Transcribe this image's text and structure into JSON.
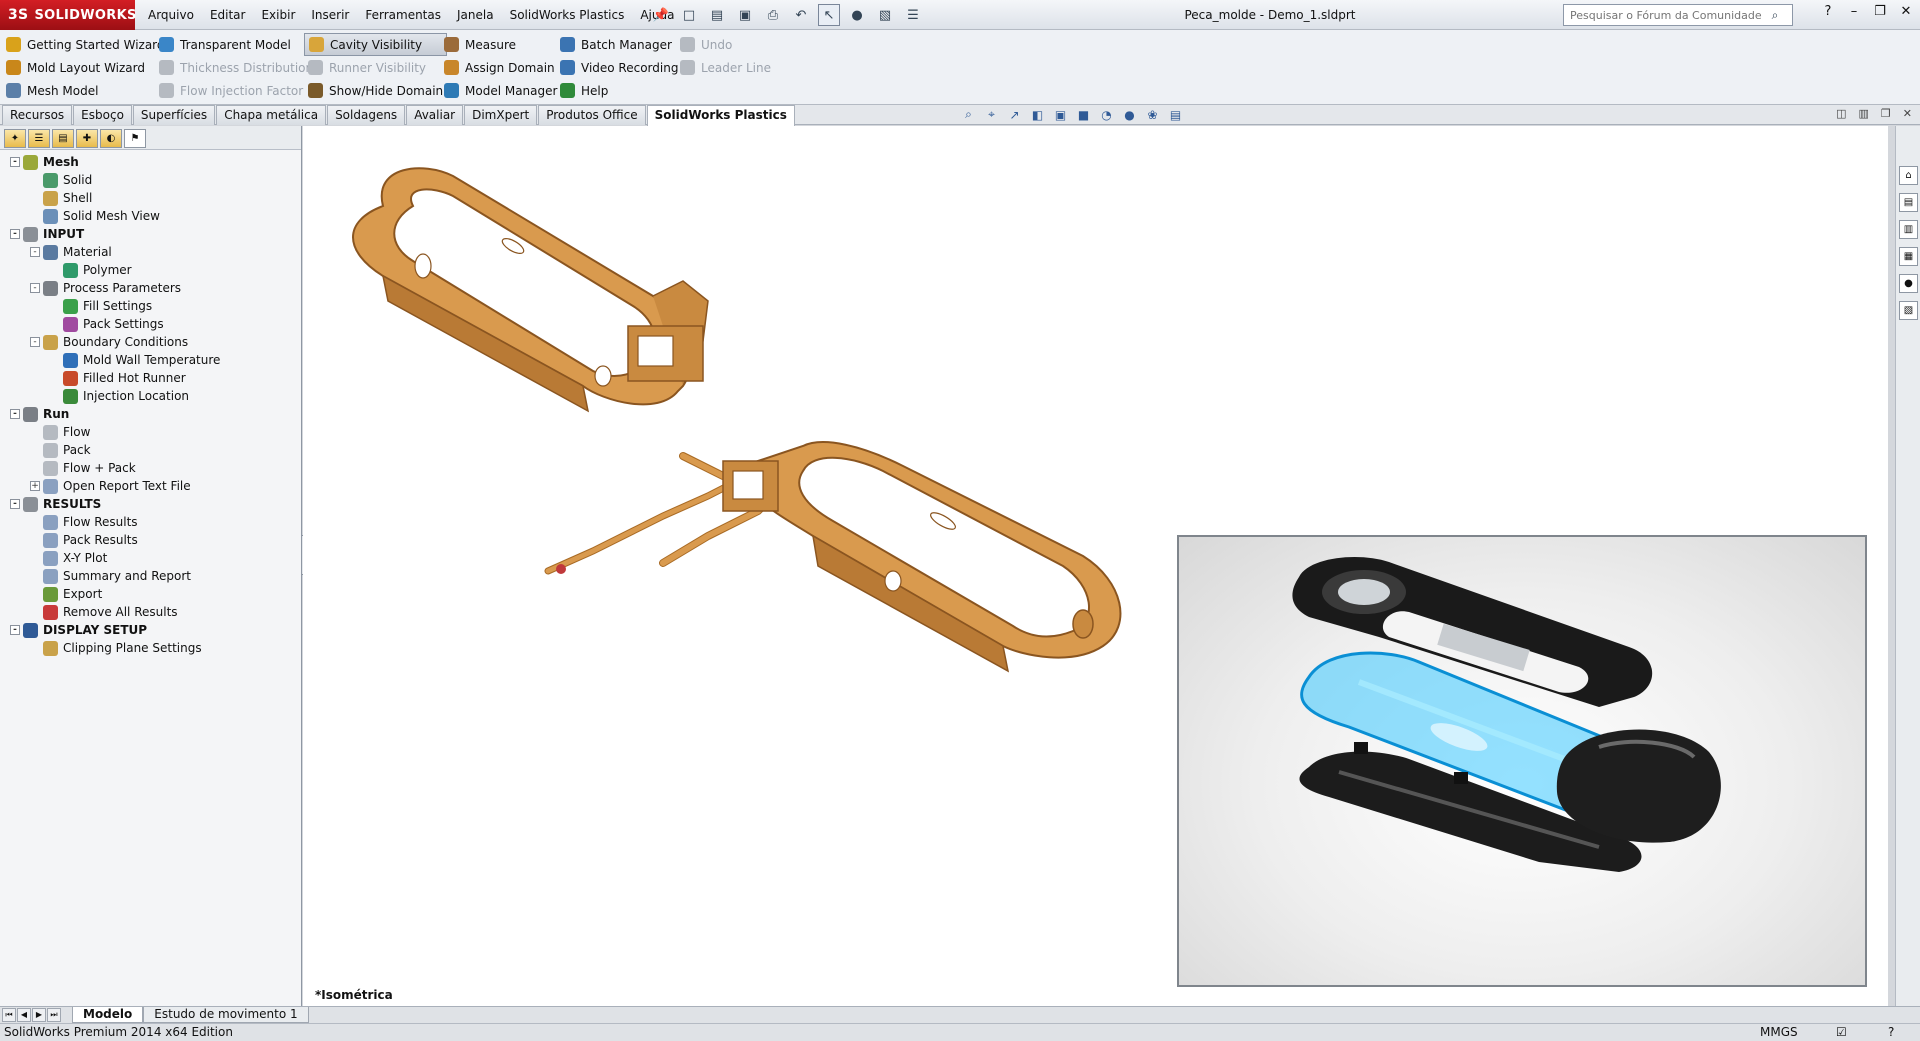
{
  "app": {
    "logo_text": "SOLIDWORKS",
    "logo_mark": "3S",
    "document_title": "Peca_molde - Demo_1.sldprt"
  },
  "menu": [
    "Arquivo",
    "Editar",
    "Exibir",
    "Inserir",
    "Ferramentas",
    "Janela",
    "SolidWorks Plastics",
    "Ajuda"
  ],
  "search": {
    "placeholder": "Pesquisar o Fórum da Comunidade",
    "value": "Pesquisar o Fórum da Comunidade"
  },
  "commands": {
    "col1": [
      {
        "label": "Getting Started Wizard",
        "icon": "wizard-icon",
        "color": "#d9a21b"
      },
      {
        "label": "Mold Layout Wizard",
        "icon": "mold-layout-icon",
        "color": "#c9871a"
      },
      {
        "label": "Mesh Model",
        "icon": "mesh-icon",
        "color": "#5b7fa8"
      }
    ],
    "col2": [
      {
        "label": "Transparent Model",
        "icon": "transparent-model-icon",
        "color": "#3a86c8"
      },
      {
        "label": "Thickness Distribution",
        "icon": "thickness-icon",
        "color": "#b5bac1",
        "disabled": true
      },
      {
        "label": "Flow Injection Factor",
        "icon": "flow-factor-icon",
        "color": "#b5bac1",
        "disabled": true
      }
    ],
    "col3": [
      {
        "label": "Cavity Visibility",
        "icon": "cavity-visibility-icon",
        "color": "#d8a53a",
        "active": true
      },
      {
        "label": "Runner Visibility",
        "icon": "runner-visibility-icon",
        "color": "#b5bac1",
        "disabled": true
      },
      {
        "label": "Show/Hide Domain",
        "icon": "show-hide-domain-icon",
        "color": "#7a5a2a"
      }
    ],
    "col4": [
      {
        "label": "Measure",
        "icon": "measure-icon",
        "color": "#9b6b3a"
      },
      {
        "label": "Assign Domain",
        "icon": "assign-domain-icon",
        "color": "#c8862a"
      },
      {
        "label": "Model Manager",
        "icon": "model-manager-icon",
        "color": "#2e7ab5"
      }
    ],
    "col5": [
      {
        "label": "Batch Manager",
        "icon": "batch-manager-icon",
        "color": "#3b74b2"
      },
      {
        "label": "Video Recording",
        "icon": "video-recording-icon",
        "color": "#3b74b2"
      },
      {
        "label": "Help",
        "icon": "help-icon",
        "color": "#2f8a3a"
      }
    ],
    "col6": [
      {
        "label": "Undo",
        "icon": "undo-icon",
        "color": "#b5bac1",
        "disabled": true
      },
      {
        "label": "Leader Line",
        "icon": "leader-line-icon",
        "color": "#b5bac1",
        "disabled": true
      }
    ]
  },
  "tabs": [
    "Recursos",
    "Esboço",
    "Superfícies",
    "Chapa metálica",
    "Soldagens",
    "Avaliar",
    "DimXpert",
    "Produtos Office",
    "SolidWorks Plastics"
  ],
  "active_tab": "SolidWorks Plastics",
  "tree": [
    {
      "label": "Mesh",
      "level": 0,
      "bold": true,
      "expand": "-",
      "icon": "mesh-icon",
      "color": "#9aa83a"
    },
    {
      "label": "Solid",
      "level": 1,
      "icon": "solid-icon",
      "color": "#4a9a6a"
    },
    {
      "label": "Shell",
      "level": 1,
      "icon": "shell-icon",
      "color": "#c9a24a"
    },
    {
      "label": "Solid Mesh View",
      "level": 1,
      "icon": "mesh-view-icon",
      "color": "#6b8fb8"
    },
    {
      "label": "INPUT",
      "level": 0,
      "bold": true,
      "expand": "-",
      "icon": "input-icon",
      "color": "#8a8f96"
    },
    {
      "label": "Material",
      "level": 1,
      "expand": "-",
      "icon": "material-icon",
      "color": "#5a7aa0"
    },
    {
      "label": "Polymer",
      "level": 2,
      "icon": "polymer-icon",
      "color": "#2f9a6a"
    },
    {
      "label": "Process Parameters",
      "level": 1,
      "expand": "-",
      "icon": "process-parameters-icon",
      "color": "#7a7f86"
    },
    {
      "label": "Fill Settings",
      "level": 2,
      "icon": "fill-settings-icon",
      "color": "#3aa04a"
    },
    {
      "label": "Pack Settings",
      "level": 2,
      "icon": "pack-settings-icon",
      "color": "#a04aa0"
    },
    {
      "label": "Boundary Conditions",
      "level": 1,
      "expand": "-",
      "icon": "boundary-conditions-icon",
      "color": "#c9a24a"
    },
    {
      "label": "Mold Wall Temperature",
      "level": 2,
      "icon": "mold-wall-temperature-icon",
      "color": "#2f6fb8"
    },
    {
      "label": "Filled Hot Runner",
      "level": 2,
      "icon": "hot-runner-icon",
      "color": "#c84a2a"
    },
    {
      "label": "Injection Location",
      "level": 2,
      "icon": "injection-location-icon",
      "color": "#3a8a3a"
    },
    {
      "label": "Run",
      "level": 0,
      "bold": true,
      "expand": "-",
      "icon": "run-icon",
      "color": "#7a7f86"
    },
    {
      "label": "Flow",
      "level": 1,
      "icon": "flow-icon",
      "color": "#b5bac1"
    },
    {
      "label": "Pack",
      "level": 1,
      "icon": "pack-icon",
      "color": "#b5bac1"
    },
    {
      "label": "Flow + Pack",
      "level": 1,
      "icon": "flow-pack-icon",
      "color": "#b5bac1"
    },
    {
      "label": "Open Report Text File",
      "level": 1,
      "expand": "+",
      "icon": "report-file-icon",
      "color": "#8aa0c0"
    },
    {
      "label": "RESULTS",
      "level": 0,
      "bold": true,
      "expand": "-",
      "icon": "results-icon",
      "color": "#8a8f96"
    },
    {
      "label": "Flow Results",
      "level": 1,
      "icon": "flow-results-icon",
      "color": "#8aa0c0"
    },
    {
      "label": "Pack Results",
      "level": 1,
      "icon": "pack-results-icon",
      "color": "#8aa0c0"
    },
    {
      "label": "X-Y Plot",
      "level": 1,
      "icon": "xy-plot-icon",
      "color": "#8aa0c0"
    },
    {
      "label": "Summary and Report",
      "level": 1,
      "icon": "summary-report-icon",
      "color": "#8aa0c0"
    },
    {
      "label": "Export",
      "level": 1,
      "icon": "export-icon",
      "color": "#6a9a3a"
    },
    {
      "label": "Remove All Results",
      "level": 1,
      "icon": "remove-results-icon",
      "color": "#c83a3a"
    },
    {
      "label": "DISPLAY SETUP",
      "level": 0,
      "bold": true,
      "expand": "-",
      "icon": "display-setup-icon",
      "color": "#2f5a96"
    },
    {
      "label": "Clipping Plane Settings",
      "level": 1,
      "icon": "clipping-plane-icon",
      "color": "#c9a24a"
    }
  ],
  "viewport": {
    "view_label": "*Isométrica"
  },
  "bottom_tabs": [
    "Modelo",
    "Estudo de movimento 1"
  ],
  "active_bottom_tab": "Modelo",
  "status": {
    "edition": "SolidWorks Premium 2014 x64 Edition",
    "units": "MMGS"
  },
  "colors": {
    "part": "#d99a4e",
    "part_dark": "#a86a24",
    "highlight_blue": "#3cc8ff",
    "logo_red": "#c4161c"
  }
}
